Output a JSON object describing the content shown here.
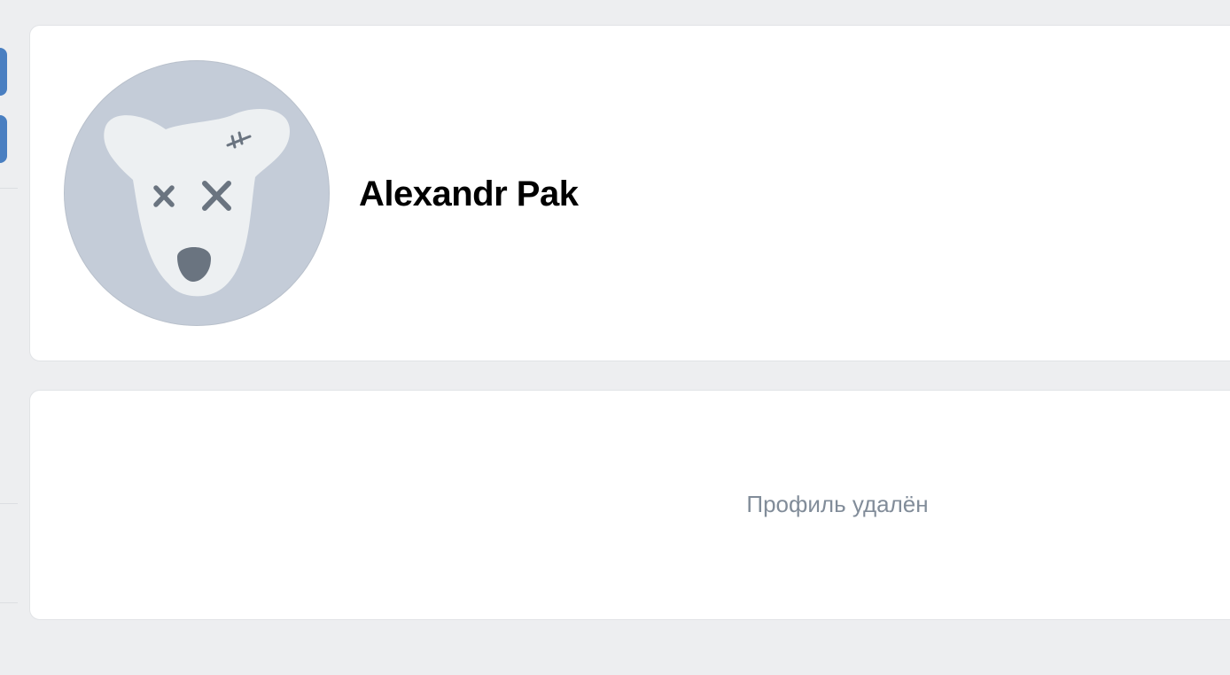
{
  "profile": {
    "name": "Alexandr Pak",
    "avatar": {
      "icon": "deactivated-dog-icon",
      "bg_color": "#c4ccd8",
      "face_color": "#edf0f2",
      "detail_color": "#6a7480"
    }
  },
  "content": {
    "status_text": "Профиль удалён"
  },
  "colors": {
    "page_bg": "#edeef0",
    "card_bg": "#ffffff",
    "accent": "#4a7fc1",
    "muted_text": "#818c99"
  }
}
